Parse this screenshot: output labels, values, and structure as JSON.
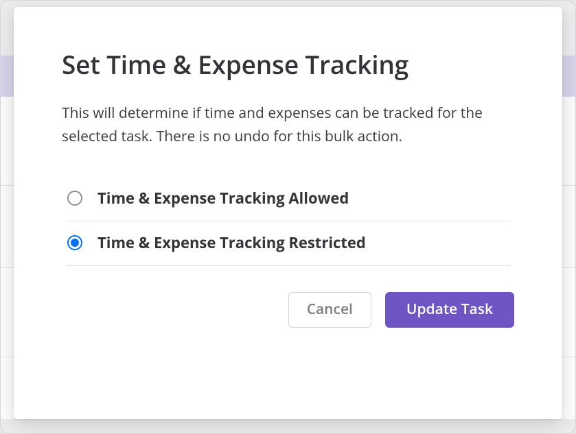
{
  "modal": {
    "title": "Set Time & Expense Tracking",
    "description": "This will determine if time and expenses can be tracked for the selected task. There is no undo for this bulk action.",
    "options": [
      {
        "id": "allowed",
        "label": "Time & Expense Tracking Allowed",
        "selected": false
      },
      {
        "id": "restricted",
        "label": "Time & Expense Tracking Restricted",
        "selected": true
      }
    ],
    "buttons": {
      "cancel": "Cancel",
      "submit": "Update Task"
    }
  },
  "colors": {
    "primary": "#6f55c4",
    "radioSelected": "#0571f0"
  }
}
